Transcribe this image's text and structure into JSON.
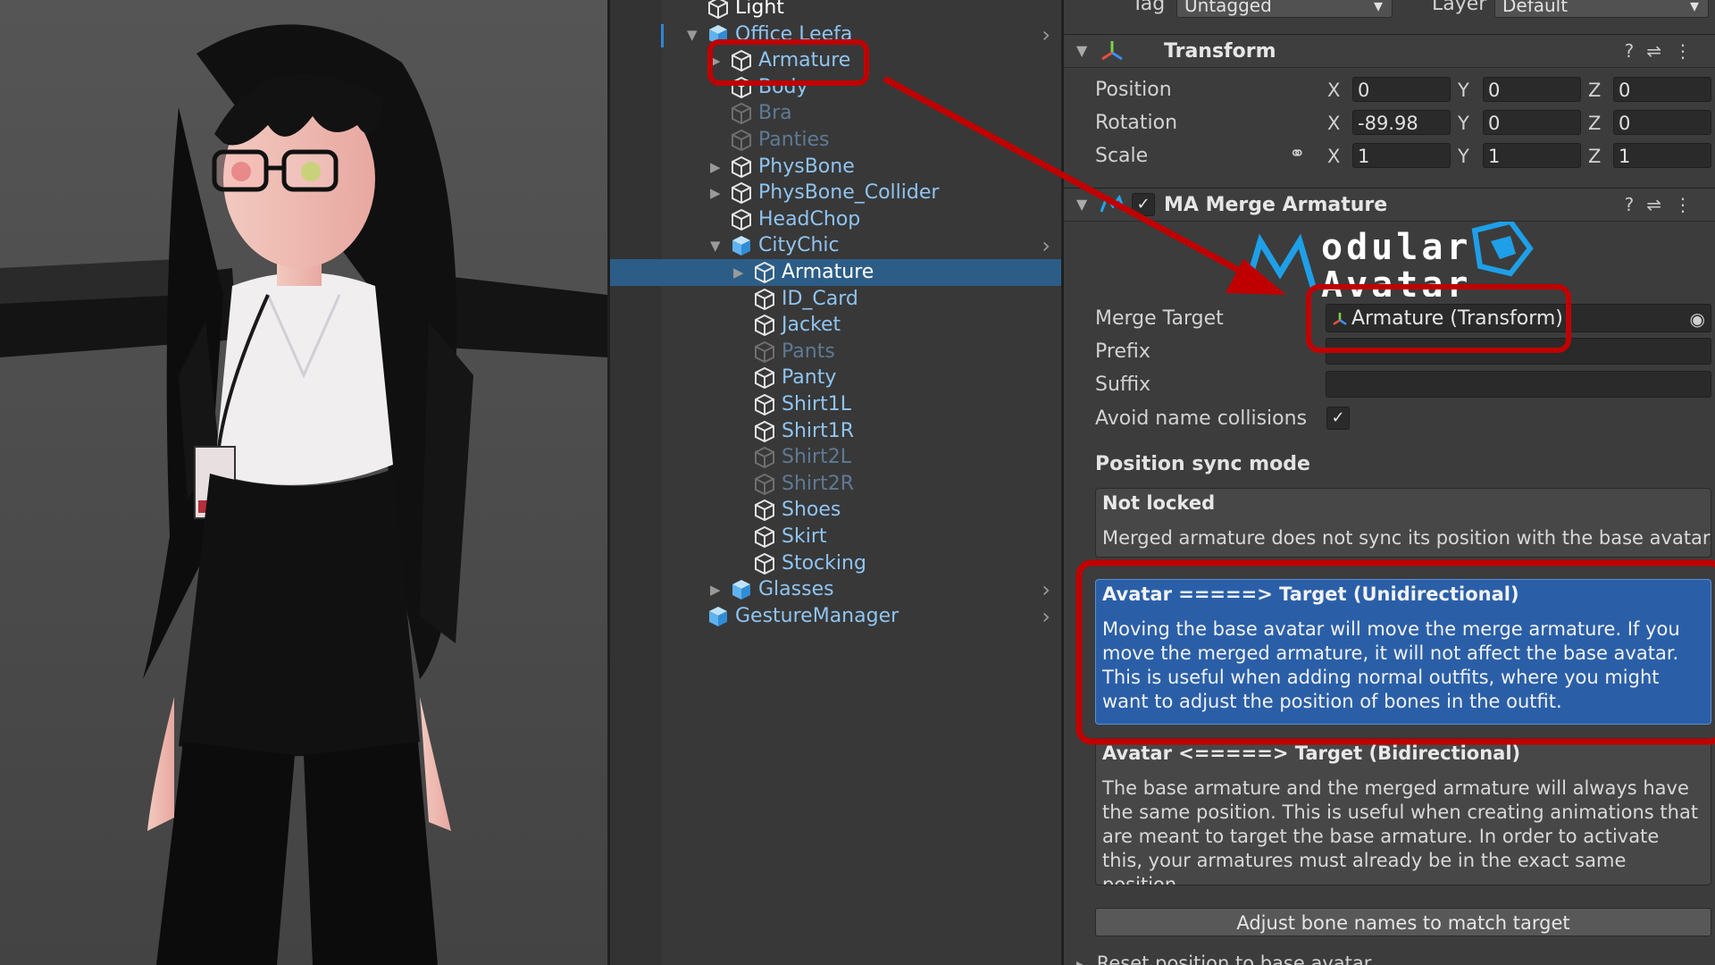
{
  "hierarchy": {
    "rows": [
      {
        "label": "Light",
        "depth": 0,
        "color": "white",
        "arrow": "",
        "kind": "cube",
        "chevron": false,
        "selected": false
      },
      {
        "label": "Office Leefa",
        "depth": 0,
        "color": "blue",
        "arrow": "down",
        "kind": "prefab",
        "chevron": true,
        "selected": false
      },
      {
        "label": "Armature",
        "depth": 1,
        "color": "blue",
        "arrow": "right",
        "kind": "cube",
        "chevron": false,
        "selected": false
      },
      {
        "label": "Body",
        "depth": 1,
        "color": "blue",
        "arrow": "",
        "kind": "cube",
        "chevron": false,
        "selected": false
      },
      {
        "label": "Bra",
        "depth": 1,
        "color": "dim",
        "arrow": "",
        "kind": "cube",
        "chevron": false,
        "selected": false
      },
      {
        "label": "Panties",
        "depth": 1,
        "color": "dim",
        "arrow": "",
        "kind": "cube",
        "chevron": false,
        "selected": false
      },
      {
        "label": "PhysBone",
        "depth": 1,
        "color": "blue",
        "arrow": "right",
        "kind": "cube",
        "chevron": false,
        "selected": false
      },
      {
        "label": "PhysBone_Collider",
        "depth": 1,
        "color": "blue",
        "arrow": "right",
        "kind": "cube",
        "chevron": false,
        "selected": false
      },
      {
        "label": "HeadChop",
        "depth": 1,
        "color": "blue",
        "arrow": "",
        "kind": "cube",
        "chevron": false,
        "selected": false
      },
      {
        "label": "CityChic",
        "depth": 1,
        "color": "blue",
        "arrow": "down",
        "kind": "prefab",
        "chevron": true,
        "selected": false
      },
      {
        "label": "Armature",
        "depth": 2,
        "color": "white",
        "arrow": "right",
        "kind": "cube",
        "chevron": false,
        "selected": true
      },
      {
        "label": "ID_Card",
        "depth": 2,
        "color": "blue",
        "arrow": "",
        "kind": "cube",
        "chevron": false,
        "selected": false
      },
      {
        "label": "Jacket",
        "depth": 2,
        "color": "blue",
        "arrow": "",
        "kind": "cube",
        "chevron": false,
        "selected": false
      },
      {
        "label": "Pants",
        "depth": 2,
        "color": "dim",
        "arrow": "",
        "kind": "cube",
        "chevron": false,
        "selected": false
      },
      {
        "label": "Panty",
        "depth": 2,
        "color": "blue",
        "arrow": "",
        "kind": "cube",
        "chevron": false,
        "selected": false
      },
      {
        "label": "Shirt1L",
        "depth": 2,
        "color": "blue",
        "arrow": "",
        "kind": "cube",
        "chevron": false,
        "selected": false
      },
      {
        "label": "Shirt1R",
        "depth": 2,
        "color": "blue",
        "arrow": "",
        "kind": "cube",
        "chevron": false,
        "selected": false
      },
      {
        "label": "Shirt2L",
        "depth": 2,
        "color": "dim",
        "arrow": "",
        "kind": "cube",
        "chevron": false,
        "selected": false
      },
      {
        "label": "Shirt2R",
        "depth": 2,
        "color": "dim",
        "arrow": "",
        "kind": "cube",
        "chevron": false,
        "selected": false
      },
      {
        "label": "Shoes",
        "depth": 2,
        "color": "blue",
        "arrow": "",
        "kind": "cube",
        "chevron": false,
        "selected": false
      },
      {
        "label": "Skirt",
        "depth": 2,
        "color": "blue",
        "arrow": "",
        "kind": "cube",
        "chevron": false,
        "selected": false
      },
      {
        "label": "Stocking",
        "depth": 2,
        "color": "blue",
        "arrow": "",
        "kind": "cube",
        "chevron": false,
        "selected": false
      },
      {
        "label": "Glasses",
        "depth": 1,
        "color": "blue",
        "arrow": "right",
        "kind": "prefab",
        "chevron": true,
        "selected": false
      },
      {
        "label": "GestureManager",
        "depth": 0,
        "color": "blue",
        "arrow": "",
        "kind": "prefab",
        "chevron": true,
        "selected": false
      }
    ]
  },
  "inspector": {
    "tag_label": "Tag",
    "tag_value": "Untagged",
    "layer_label": "Layer",
    "layer_value": "Default",
    "transform": {
      "title": "Transform",
      "position_label": "Position",
      "rotation_label": "Rotation",
      "scale_label": "Scale",
      "axis_x": "X",
      "axis_y": "Y",
      "axis_z": "Z",
      "position": {
        "x": "0",
        "y": "0",
        "z": "0"
      },
      "rotation": {
        "x": "-89.98",
        "y": "0",
        "z": "0"
      },
      "scale": {
        "x": "1",
        "y": "1",
        "z": "1"
      }
    },
    "merge": {
      "title": "MA Merge Armature",
      "logo_line1": "odular",
      "logo_line2": "Avatar",
      "merge_target_label": "Merge Target",
      "merge_target_value": "Armature (Transform)",
      "prefix_label": "Prefix",
      "suffix_label": "Suffix",
      "avoid_label": "Avoid name collisions",
      "sync_heading": "Position sync mode",
      "opt1_title": "Not locked",
      "opt1_desc": "Merged armature does not sync its position with the base avatar.",
      "opt2_title": "Avatar =====> Target (Unidirectional)",
      "opt2_desc": "Moving the base avatar will move the merge armature. If you move the merged armature, it will not affect the base avatar. This is useful when adding normal outfits, where you might want to adjust the position of bones in the outfit.",
      "opt3_title": "Avatar <=====> Target (Bidirectional)",
      "opt3_desc": "The base armature and the merged armature will always have the same position. This is useful when creating animations that are meant to target the base armature. In order to activate this, your armatures must already be in the exact same position.",
      "adjust_button": "Adjust bone names to match target",
      "reset_label": "Reset position to base avatar"
    }
  },
  "colors": {
    "annotation": "#c00000",
    "selection": "#2c5d87",
    "option_selected": "#2a5fa8",
    "prefab_blue": "#8fc4f1"
  }
}
